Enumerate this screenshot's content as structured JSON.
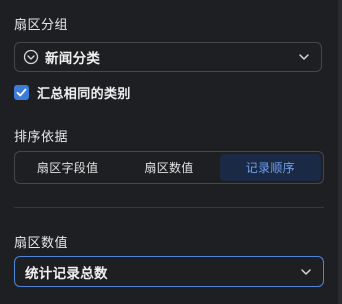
{
  "colors": {
    "background": "#1e1f22",
    "accent": "#3b7bd9",
    "active_segment_text": "#6f9ff0",
    "focused_border": "#4d86d8"
  },
  "group_section": {
    "label": "扇区分组",
    "select_value": "新闻分类",
    "leading_icon": "circle-chevron-down-icon",
    "trailing_icon": "chevron-down-icon"
  },
  "aggregate": {
    "checked": true,
    "label": "汇总相同的类别"
  },
  "sort_section": {
    "label": "排序依据",
    "options": [
      "扇区字段值",
      "扇区数值",
      "记录顺序"
    ],
    "selected": "记录顺序"
  },
  "value_section": {
    "label": "扇区数值",
    "select_value": "统计记录总数",
    "trailing_icon": "chevron-down-icon"
  }
}
